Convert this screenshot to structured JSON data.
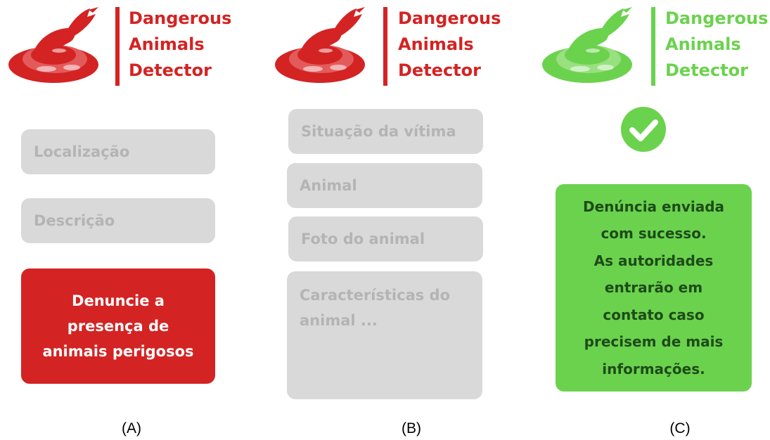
{
  "app": {
    "title": "Dangerous\nAnimals\nDetector",
    "red": "#d42323",
    "green": "#6bd24e"
  },
  "screen_a": {
    "fields": [
      {
        "placeholder": "Localização"
      },
      {
        "placeholder": "Descrição"
      }
    ],
    "submit_label": "Denuncie a\npresença de\nanimais perigosos",
    "caption": "(A)"
  },
  "screen_b": {
    "fields": [
      {
        "placeholder": "Situação da vítima"
      },
      {
        "placeholder": "Animal"
      },
      {
        "placeholder": "Foto do animal"
      },
      {
        "placeholder": "Características do\nanimal ..."
      }
    ],
    "caption": "(B)"
  },
  "screen_c": {
    "icon": "check-circle-icon",
    "message": "Denúncia enviada\ncom sucesso.\nAs autoridades\nentrarão em\ncontato caso\nprecisem de mais\ninformações.",
    "caption": "(C)"
  }
}
